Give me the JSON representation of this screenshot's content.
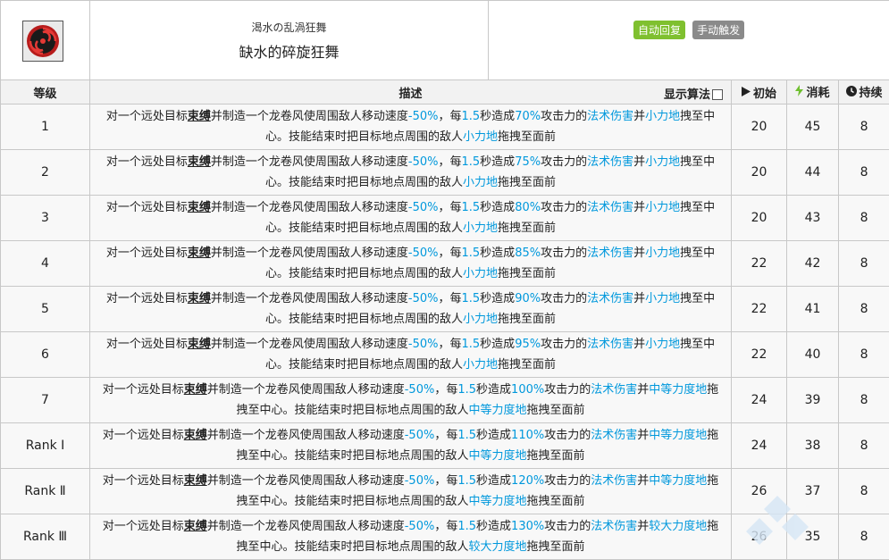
{
  "skill": {
    "icon": "red-black-swirl-skill-icon",
    "subname": "渴水の乱渦狂舞",
    "name": "缺水的碎旋狂舞",
    "tags": [
      {
        "label": "自动回复",
        "color": "#7fc02f"
      },
      {
        "label": "手动触发",
        "color": "#8a8a8a"
      }
    ]
  },
  "columns": {
    "level": "等级",
    "desc": "描述",
    "show_algo": "显示算法",
    "initial": "初始",
    "cost": "消耗",
    "duration": "持续"
  },
  "rows": [
    {
      "level": "1",
      "line1_pre": "对一个远处目标",
      "bind": "束缚",
      "line1_mid": "并制造一个龙卷风使周围敌人移动速度",
      "slow": "-50%",
      "mid2": "，每",
      "interval": "1.5",
      "mid3": "秒造成",
      "pct": "70%",
      "mid4": "攻击力的",
      "dmg": "法术伤害",
      "mid5": "并",
      "force": "小力地",
      "line2_pre": "拽至中心。技能结束时把目标地点周围的敌人",
      "force2": "小力地",
      "line2_post": "拖拽至面前",
      "initial": "20",
      "cost": "45",
      "duration": "8"
    },
    {
      "level": "2",
      "line1_pre": "对一个远处目标",
      "bind": "束缚",
      "line1_mid": "并制造一个龙卷风使周围敌人移动速度",
      "slow": "-50%",
      "mid2": "，每",
      "interval": "1.5",
      "mid3": "秒造成",
      "pct": "75%",
      "mid4": "攻击力的",
      "dmg": "法术伤害",
      "mid5": "并",
      "force": "小力地",
      "line2_pre": "拽至中心。技能结束时把目标地点周围的敌人",
      "force2": "小力地",
      "line2_post": "拖拽至面前",
      "initial": "20",
      "cost": "44",
      "duration": "8"
    },
    {
      "level": "3",
      "line1_pre": "对一个远处目标",
      "bind": "束缚",
      "line1_mid": "并制造一个龙卷风使周围敌人移动速度",
      "slow": "-50%",
      "mid2": "，每",
      "interval": "1.5",
      "mid3": "秒造成",
      "pct": "80%",
      "mid4": "攻击力的",
      "dmg": "法术伤害",
      "mid5": "并",
      "force": "小力地",
      "line2_pre": "拽至中心。技能结束时把目标地点周围的敌人",
      "force2": "小力地",
      "line2_post": "拖拽至面前",
      "initial": "20",
      "cost": "43",
      "duration": "8"
    },
    {
      "level": "4",
      "line1_pre": "对一个远处目标",
      "bind": "束缚",
      "line1_mid": "并制造一个龙卷风使周围敌人移动速度",
      "slow": "-50%",
      "mid2": "，每",
      "interval": "1.5",
      "mid3": "秒造成",
      "pct": "85%",
      "mid4": "攻击力的",
      "dmg": "法术伤害",
      "mid5": "并",
      "force": "小力地",
      "line2_pre": "拽至中心。技能结束时把目标地点周围的敌人",
      "force2": "小力地",
      "line2_post": "拖拽至面前",
      "initial": "22",
      "cost": "42",
      "duration": "8"
    },
    {
      "level": "5",
      "line1_pre": "对一个远处目标",
      "bind": "束缚",
      "line1_mid": "并制造一个龙卷风使周围敌人移动速度",
      "slow": "-50%",
      "mid2": "，每",
      "interval": "1.5",
      "mid3": "秒造成",
      "pct": "90%",
      "mid4": "攻击力的",
      "dmg": "法术伤害",
      "mid5": "并",
      "force": "小力地",
      "line2_pre": "拽至中心。技能结束时把目标地点周围的敌人",
      "force2": "小力地",
      "line2_post": "拖拽至面前",
      "initial": "22",
      "cost": "41",
      "duration": "8"
    },
    {
      "level": "6",
      "line1_pre": "对一个远处目标",
      "bind": "束缚",
      "line1_mid": "并制造一个龙卷风使周围敌人移动速度",
      "slow": "-50%",
      "mid2": "，每",
      "interval": "1.5",
      "mid3": "秒造成",
      "pct": "95%",
      "mid4": "攻击力的",
      "dmg": "法术伤害",
      "mid5": "并",
      "force": "小力地",
      "line2_pre": "拽至中心。技能结束时把目标地点周围的敌人",
      "force2": "小力地",
      "line2_post": "拖拽至面前",
      "initial": "22",
      "cost": "40",
      "duration": "8"
    },
    {
      "level": "7",
      "line1_pre": "对一个远处目标",
      "bind": "束缚",
      "line1_mid": "并制造一个龙卷风使周围敌人移动速度",
      "slow": "-50%",
      "mid2": "，每",
      "interval": "1.5",
      "mid3": "秒造成",
      "pct": "100%",
      "mid4": "攻击力的",
      "dmg": "法术伤害",
      "mid5": "并",
      "force": "中等力度地",
      "line2_pre": "拖拽至中心。技能结束时把目标地点周围的敌人",
      "force2": "中等力度地",
      "line2_post": "拖拽至面前",
      "initial": "24",
      "cost": "39",
      "duration": "8"
    },
    {
      "level": "Rank Ⅰ",
      "line1_pre": "对一个远处目标",
      "bind": "束缚",
      "line1_mid": "并制造一个龙卷风使周围敌人移动速度",
      "slow": "-50%",
      "mid2": "，每",
      "interval": "1.5",
      "mid3": "秒造成",
      "pct": "110%",
      "mid4": "攻击力的",
      "dmg": "法术伤害",
      "mid5": "并",
      "force": "中等力度地",
      "line2_pre": "拖拽至中心。技能结束时把目标地点周围的敌人",
      "force2": "中等力度地",
      "line2_post": "拖拽至面前",
      "initial": "24",
      "cost": "38",
      "duration": "8"
    },
    {
      "level": "Rank Ⅱ",
      "line1_pre": "对一个远处目标",
      "bind": "束缚",
      "line1_mid": "并制造一个龙卷风使周围敌人移动速度",
      "slow": "-50%",
      "mid2": "，每",
      "interval": "1.5",
      "mid3": "秒造成",
      "pct": "120%",
      "mid4": "攻击力的",
      "dmg": "法术伤害",
      "mid5": "并",
      "force": "中等力度地",
      "line2_pre": "拖拽至中心。技能结束时把目标地点周围的敌人",
      "force2": "中等力度地",
      "line2_post": "拖拽至面前",
      "initial": "26",
      "cost": "37",
      "duration": "8"
    },
    {
      "level": "Rank Ⅲ",
      "line1_pre": "对一个远处目标",
      "bind": "束缚",
      "line1_mid": "并制造一个龙卷风使周围敌人移动速度",
      "slow": "-50%",
      "mid2": "，每",
      "interval": "1.5",
      "mid3": "秒造成",
      "pct": "130%",
      "mid4": "攻击力的",
      "dmg": "法术伤害",
      "mid5": "并",
      "force": "较大力度地",
      "line2_pre": "拖拽至中心。技能结束时把目标地点周围的敌人",
      "force2": "较大力度地",
      "line2_post": "拖拽至面前",
      "initial": "26",
      "cost": "35",
      "duration": "8"
    }
  ]
}
